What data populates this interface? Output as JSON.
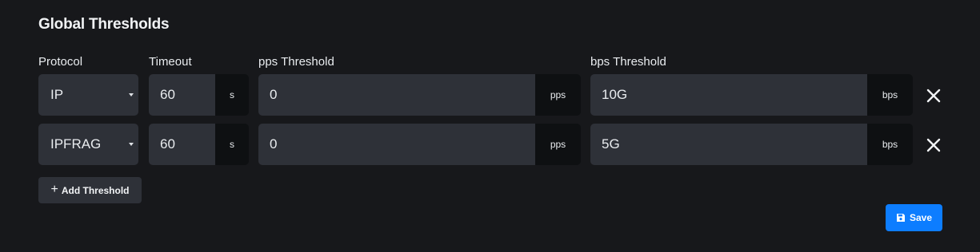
{
  "title": "Global Thresholds",
  "columns": {
    "protocol": "Protocol",
    "timeout": "Timeout",
    "pps": "pps Threshold",
    "bps": "bps Threshold"
  },
  "rows": [
    {
      "protocol": "IP",
      "timeout": "60",
      "timeout_unit": "s",
      "pps": "0",
      "pps_unit": "pps",
      "bps": "10G",
      "bps_unit": "bps"
    },
    {
      "protocol": "IPFRAG",
      "timeout": "60",
      "timeout_unit": "s",
      "pps": "0",
      "pps_unit": "pps",
      "bps": "5G",
      "bps_unit": "bps"
    }
  ],
  "buttons": {
    "add_plus": "+",
    "add_label": "Add Threshold",
    "save_label": "Save"
  },
  "icons": {
    "remove": "close-icon",
    "save": "floppy-disk-icon",
    "caret": "caret-down-icon"
  },
  "colors": {
    "background": "#17181b",
    "field": "#2e3138",
    "suffix": "#0e1012",
    "primary": "#0d7dff"
  }
}
